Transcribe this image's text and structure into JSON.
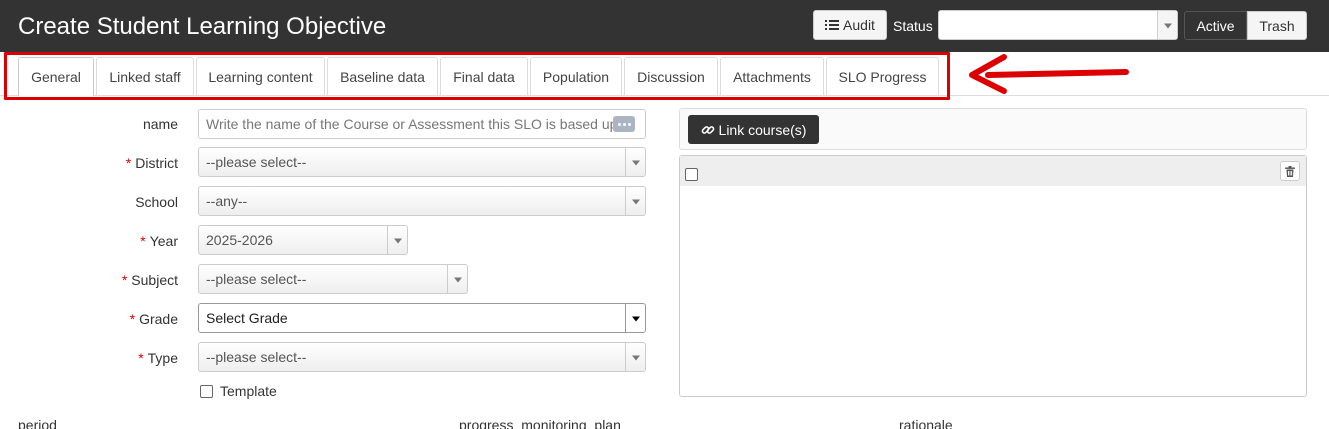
{
  "header": {
    "title": "Create Student Learning Objective",
    "audit_label": "Audit",
    "status_label": "Status",
    "status_value": "",
    "active_label": "Active",
    "trash_label": "Trash"
  },
  "tabs": [
    {
      "label": "General",
      "selected": true
    },
    {
      "label": "Linked staff"
    },
    {
      "label": "Learning content"
    },
    {
      "label": "Baseline data"
    },
    {
      "label": "Final data"
    },
    {
      "label": "Population"
    },
    {
      "label": "Discussion"
    },
    {
      "label": "Attachments"
    },
    {
      "label": "SLO Progress"
    }
  ],
  "form": {
    "name": {
      "label": "name",
      "placeholder": "Write the name of the Course or Assessment this SLO is based upon"
    },
    "district": {
      "label": "District",
      "required": true,
      "value": "--please select--"
    },
    "school": {
      "label": "School",
      "value": "--any--"
    },
    "year": {
      "label": "Year",
      "required": true,
      "value": "2025-2026"
    },
    "subject": {
      "label": "Subject",
      "required": true,
      "value": "--please select--"
    },
    "grade": {
      "label": "Grade",
      "required": true,
      "value": "Select Grade"
    },
    "type": {
      "label": "Type",
      "required": true,
      "value": "--please select--"
    },
    "template": {
      "label": "Template",
      "checked": false
    }
  },
  "courses_panel": {
    "link_button": "Link course(s)"
  },
  "bottom_labels": [
    "period",
    "progress_monitoring_plan",
    "rationale"
  ],
  "colors": {
    "header_bg": "#333333",
    "annotation": "#dd0000",
    "required": "#dd0000"
  }
}
